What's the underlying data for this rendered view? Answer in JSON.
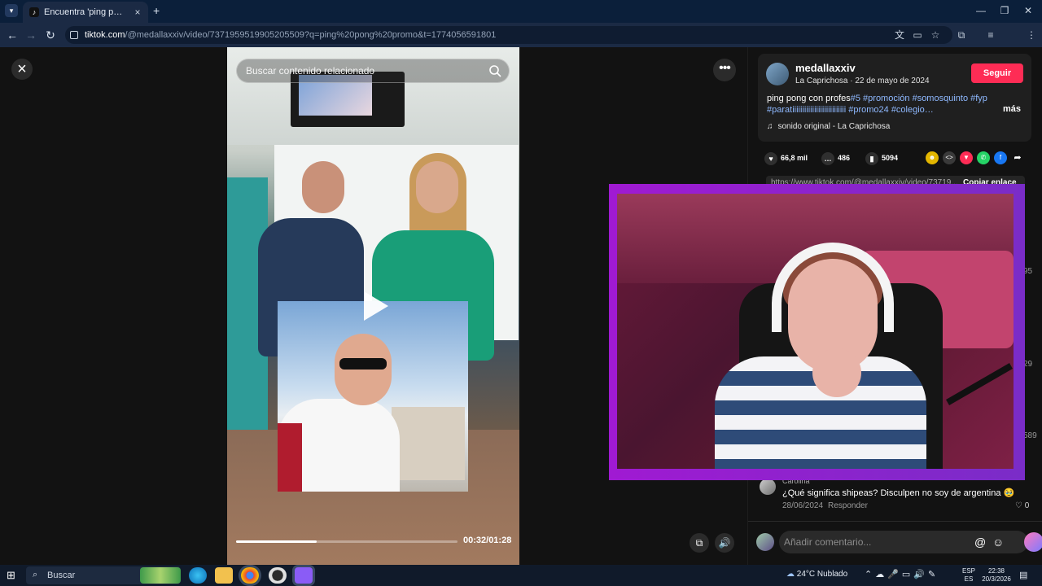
{
  "browser": {
    "tab_title": "Encuentra 'ping pong promo' e",
    "tab_close": "×",
    "new_tab": "+",
    "window_minimize": "—",
    "window_restore": "❐",
    "window_close": "✕",
    "url_host": "tiktok.com",
    "url_path": "/@medallaxxiv/video/7371959519905205509?q=ping%20pong%20promo&t=1774056591801"
  },
  "video": {
    "search_placeholder": "Buscar contenido relacionado",
    "time": "00:32/01:28",
    "progress": 0.364
  },
  "panel": {
    "username": "medallaxxiv",
    "subline": "La Caprichosa · 22 de mayo de 2024",
    "follow": "Seguir",
    "desc_text": "ping pong con profes",
    "desc_tags": "#5 #promoción #somosquinto #fyp #paratiiiiiiiiiiiiiiiiiiiiiiiiiii #promo24 #colegio…",
    "more": "más",
    "sound": "sonido original - La Caprichosa",
    "likes": "66,8 mil",
    "comments": "486",
    "saves": "5094",
    "link": "https://www.tiktok.com/@medallaxxiv/video/73719...",
    "copy": "Copiar enlace",
    "side_counts": [
      "95",
      "29",
      "589"
    ]
  },
  "comment": {
    "name": "Carolina",
    "text": "¿Qué significa shipeas? Disculpen no soy de argentina 🥹",
    "date": "28/06/2024",
    "reply": "Responder",
    "likes": "0"
  },
  "comment_input": {
    "placeholder": "Añadir comentario..."
  },
  "taskbar": {
    "search": "Buscar",
    "weather": "24°C  Nublado",
    "lang_top": "ESP",
    "lang_bottom": "ES",
    "time": "22:38",
    "date": "20/3/2026"
  }
}
